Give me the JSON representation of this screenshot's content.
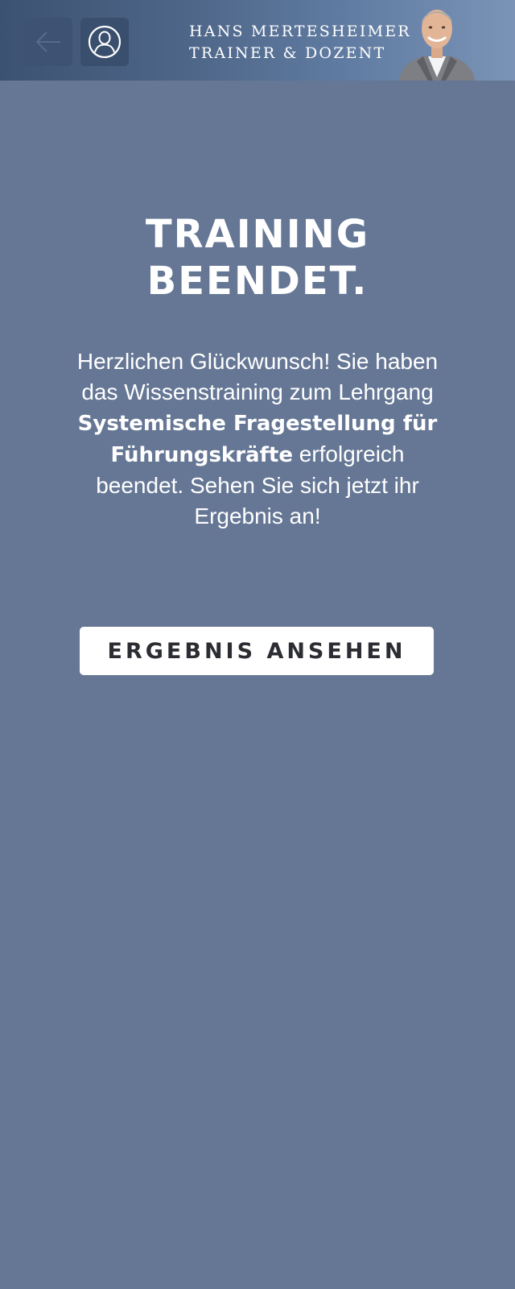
{
  "header": {
    "brand_line1": "HANS MERTESHEIMER",
    "brand_line2": "TRAINER & DOZENT",
    "back_icon": "arrow-left-icon",
    "profile_icon": "user-profile-icon"
  },
  "main": {
    "title_line1": "TRAINING",
    "title_line2": "BEENDET.",
    "message_intro": "Herzlichen Glückwunsch! Sie haben das Wissenstraining zum Lehrgang",
    "course_name": "Systemische Fragestellung für Führungskräfte",
    "message_outro": "erfolgreich beendet. Sehen Sie sich jetzt ihr Ergebnis an!",
    "cta_label": "ERGEBNIS ANSEHEN"
  },
  "colors": {
    "background": "#657795",
    "header_gradient_start": "#3c5272",
    "header_gradient_end": "#7a93b7",
    "button_bg": "#ffffff",
    "button_text": "#2c2d33"
  }
}
